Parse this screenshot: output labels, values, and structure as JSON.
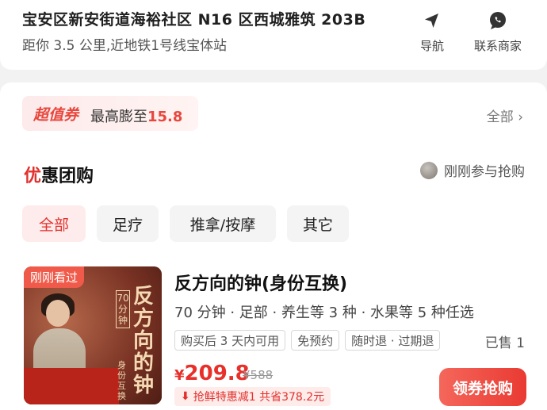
{
  "header": {
    "address": "宝安区新安街道海裕社区 N16 区西城雅筑 203B",
    "distance": "距你 3.5 公里,近地铁1号线宝体站",
    "actions": [
      {
        "label": "导航",
        "icon": "navigation-arrow-icon"
      },
      {
        "label": "联系商家",
        "icon": "chat-bubble-icon"
      }
    ]
  },
  "coupon": {
    "badge": "超值券",
    "text_prefix": "最高膨至",
    "amount": "15.8",
    "all_label": "全部"
  },
  "section": {
    "title_first": "优",
    "title_rest": "惠团购",
    "recent_label": "刚刚参与抢购"
  },
  "tabs": [
    {
      "label": "全部",
      "active": true
    },
    {
      "label": "足疗",
      "active": false
    },
    {
      "label": "推拿/按摩",
      "active": false
    },
    {
      "label": "其它",
      "active": false
    }
  ],
  "deal": {
    "seen_tag": "刚刚看过",
    "thumb_title": "反方向的钟",
    "thumb_small": "70分钟",
    "thumb_sub": "身份互换",
    "title": "反方向的钟(身份互换)",
    "desc": "70 分钟 · 足部 · 养生等 3 种 · 水果等 5 种任选",
    "tags": [
      "购买后 3 天内可用",
      "免预约",
      "随时退 · 过期退"
    ],
    "sold": "已售 1",
    "currency": "¥",
    "price": "209.8",
    "original_price": "¥588",
    "promo": "抢鲜特惠减1  共省378.2元",
    "button": "领券抢购"
  },
  "colors": {
    "accent": "#e8302a",
    "tab_active_bg": "#fdeceb"
  }
}
